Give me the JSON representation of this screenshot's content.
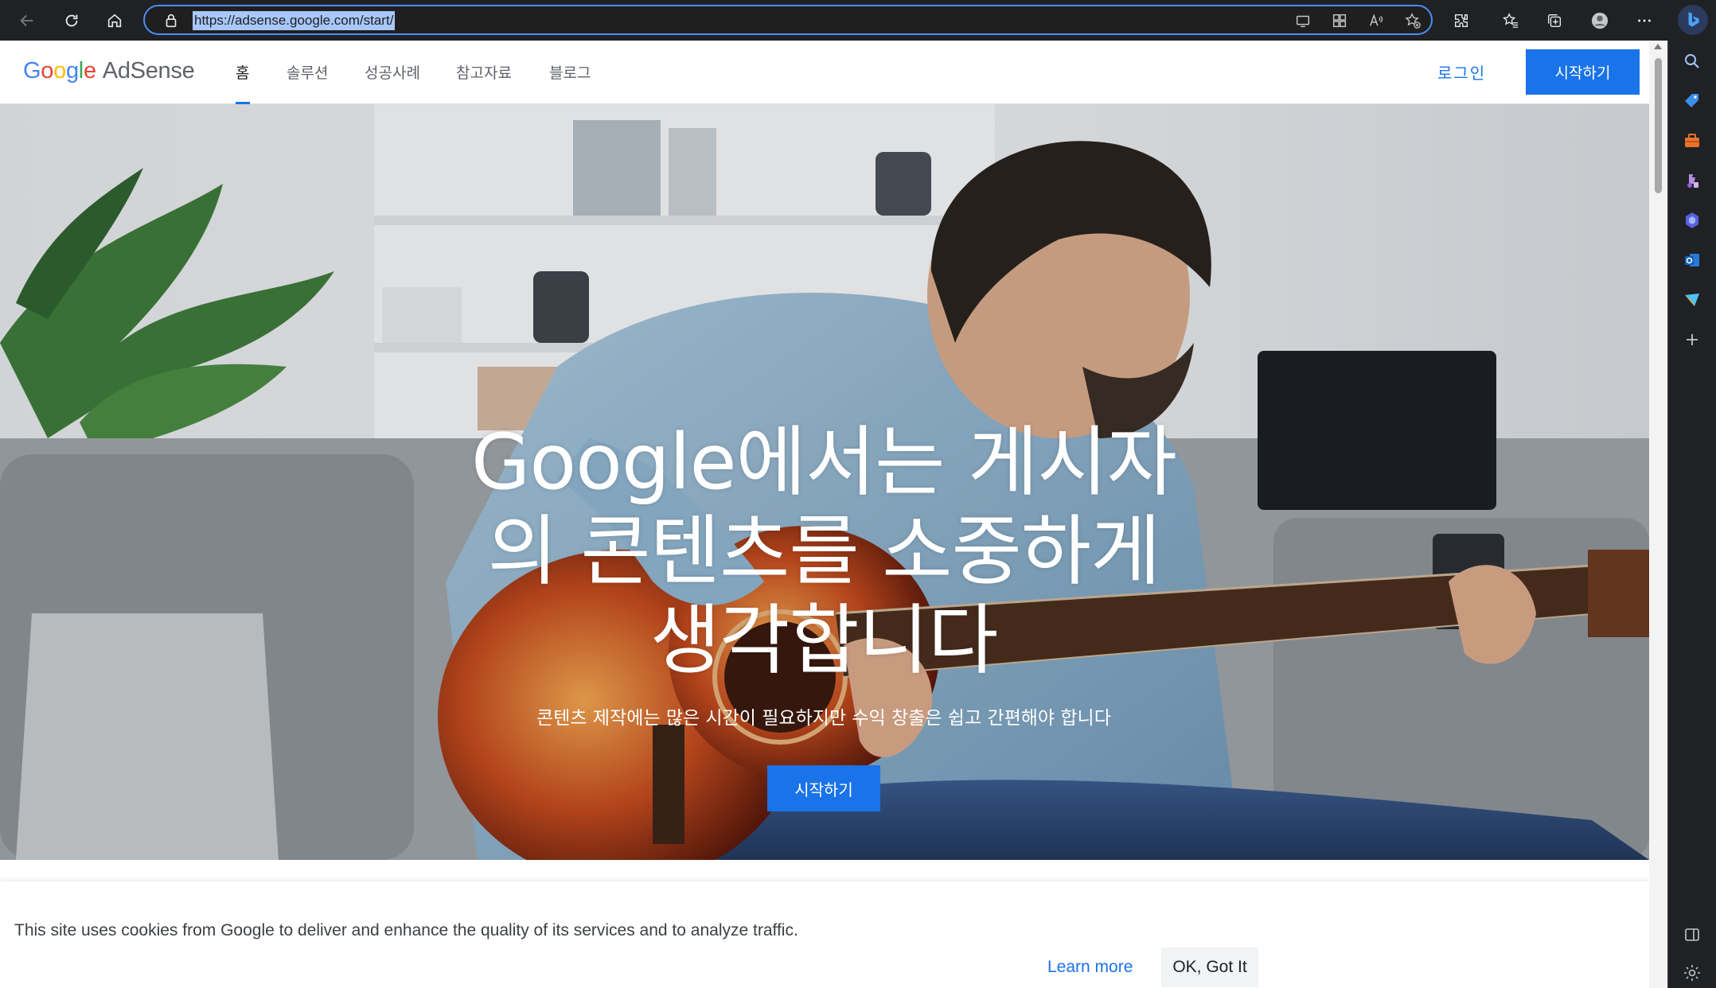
{
  "browser": {
    "url": "https://adsense.google.com/start/",
    "toolbar_icons": [
      "back-icon",
      "refresh-icon",
      "home-icon",
      "lock-icon",
      "immersive-reader-icon",
      "app-available-icon",
      "read-aloud-icon",
      "add-favorite-icon",
      "extensions-icon",
      "favorites-icon",
      "collections-icon",
      "profile-icon",
      "more-icon",
      "bing-copilot-icon"
    ],
    "sidebar_icons": [
      "search-icon",
      "shopping-tag-icon",
      "tools-icon",
      "games-icon",
      "microsoft-365-icon",
      "outlook-icon",
      "send-icon",
      "add-icon",
      "sidebar-toggle-icon",
      "settings-icon"
    ]
  },
  "header": {
    "logo": {
      "google_letters": [
        "G",
        "o",
        "o",
        "g",
        "l",
        "e"
      ],
      "product": "AdSense"
    },
    "nav": [
      {
        "label": "홈",
        "active": true
      },
      {
        "label": "솔루션",
        "active": false
      },
      {
        "label": "성공사례",
        "active": false
      },
      {
        "label": "참고자료",
        "active": false
      },
      {
        "label": "블로그",
        "active": false
      }
    ],
    "login_label": "로그인",
    "cta_label": "시작하기"
  },
  "hero": {
    "title_lines": [
      "Google에서는 게시자",
      "의 콘텐츠를 소중하게",
      "생각합니다"
    ],
    "subtitle": "콘텐츠 제작에는 많은 시간이 필요하지만 수익 창출은 쉽고 간편해야 합니다",
    "cta_label": "시작하기"
  },
  "cookie_banner": {
    "text": "This site uses cookies from Google to deliver and enhance the quality of its services and to analyze traffic.",
    "learn_more_label": "Learn more",
    "ok_label": "OK, Got It"
  },
  "colors": {
    "accent_blue": "#1a73e8",
    "browser_chrome": "#202124",
    "address_highlight": "#a8c7fa"
  }
}
